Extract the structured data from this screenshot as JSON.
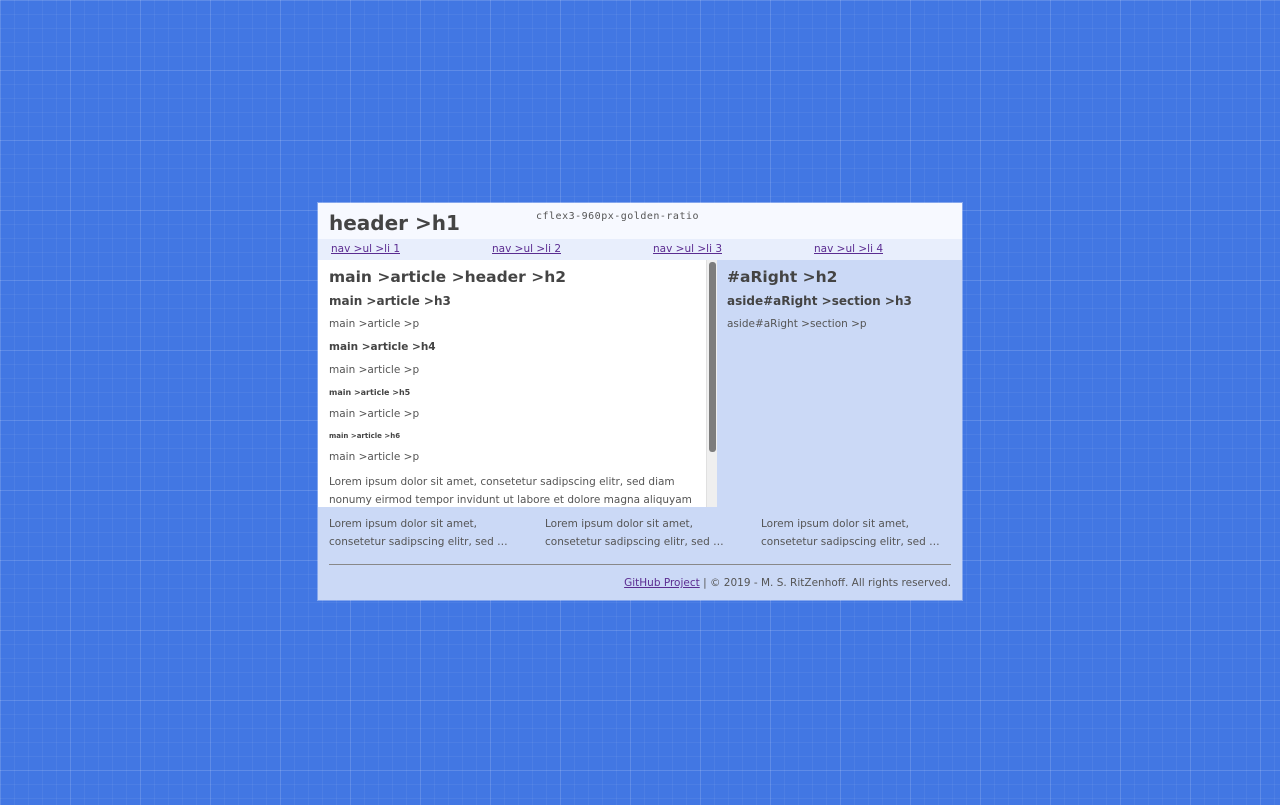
{
  "header": {
    "title": "header >h1",
    "theme_name": "cflex3-960px-golden-ratio"
  },
  "nav": {
    "items": [
      {
        "label": "nav >ul >li 1"
      },
      {
        "label": "nav >ul >li 2"
      },
      {
        "label": "nav >ul >li 3"
      },
      {
        "label": "nav >ul >li 4"
      }
    ]
  },
  "main": {
    "h2": "main >article >header >h2",
    "h3": "main >article >h3",
    "p1": "main >article >p",
    "h4": "main >article >h4",
    "p2": "main >article >p",
    "h5": "main >article >h5",
    "p3": "main >article >p",
    "h6": "main >article >h6",
    "p4": "main >article >p",
    "lorem": "Lorem ipsum dolor sit amet, consetetur sadipscing elitr, sed diam nonumy eirmod tempor invidunt ut labore et dolore magna aliquyam"
  },
  "aside": {
    "h2": "#aRight >h2",
    "h3": "aside#aRight >section >h3",
    "p": "aside#aRight >section >p"
  },
  "footer": {
    "columns": [
      {
        "line1": "Lorem ipsum dolor sit amet,",
        "line2": "consetetur sadipscing elitr, sed …"
      },
      {
        "line1": "Lorem ipsum dolor sit amet,",
        "line2": "consetetur sadipscing elitr, sed …"
      },
      {
        "line1": "Lorem ipsum dolor sit amet,",
        "line2": "consetetur sadipscing elitr, sed …"
      }
    ],
    "github_link": "GitHub Project",
    "copyright": " | © 2019 - M. S. RitZenhoff. All rights reserved."
  },
  "colors": {
    "background": "#4277e3",
    "panel": "#cbd9f6",
    "link": "#5b2c91",
    "text": "#444444"
  }
}
